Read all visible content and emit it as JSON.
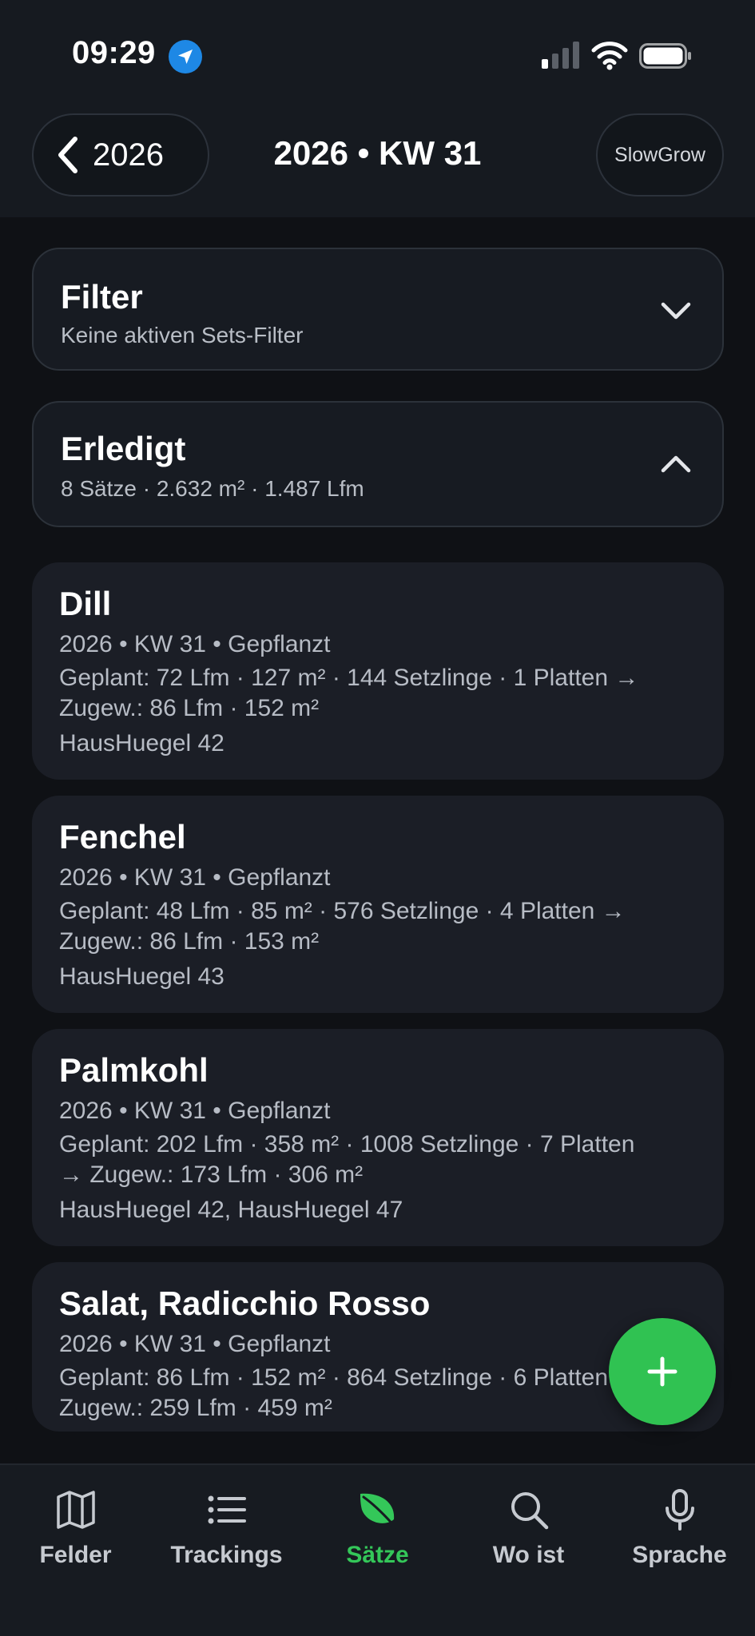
{
  "status_bar": {
    "time": "09:29"
  },
  "nav": {
    "back_label": "2026",
    "title": "2026 • KW 31",
    "right_label": "SlowGrow"
  },
  "filter": {
    "title": "Filter",
    "subtitle": "Keine aktiven Sets-Filter"
  },
  "erledigt": {
    "title": "Erledigt",
    "subtitle": "8 Sätze · 2.632 m² · 1.487 Lfm"
  },
  "sets": [
    {
      "name": "Dill",
      "meta": "2026 • KW 31 • Gepflanzt",
      "line1": "Geplant: 72 Lfm · 127 m² · 144 Setzlinge · 1 Platten →",
      "line2": "Zugew.: 86 Lfm · 152 m²",
      "location": "HausHuegel 42"
    },
    {
      "name": "Fenchel",
      "meta": "2026 • KW 31 • Gepflanzt",
      "line1": "Geplant: 48 Lfm · 85 m² · 576 Setzlinge · 4 Platten →",
      "line2": "Zugew.: 86 Lfm · 153 m²",
      "location": "HausHuegel 43"
    },
    {
      "name": "Palmkohl",
      "meta": "2026 • KW 31 • Gepflanzt",
      "line1": "Geplant: 202 Lfm · 358 m² · 1008 Setzlinge · 7 Platten",
      "line2": "→ Zugew.: 173 Lfm · 306 m²",
      "location": "HausHuegel 42, HausHuegel 47"
    },
    {
      "name": "Salat, Radicchio Rosso",
      "meta": "2026 • KW 31 • Gepflanzt",
      "line1": "Geplant: 86 Lfm · 152 m² · 864 Setzlinge · 6 Platten →",
      "line2": "Zugew.: 259 Lfm · 459 m²",
      "location": ""
    }
  ],
  "fab": {
    "icon": "plus-icon"
  },
  "tabs": [
    {
      "label": "Felder",
      "icon": "map-icon"
    },
    {
      "label": "Trackings",
      "icon": "list-icon"
    },
    {
      "label": "Sätze",
      "icon": "leaf-icon",
      "active": true
    },
    {
      "label": "Wo ist",
      "icon": "search-icon"
    },
    {
      "label": "Sprache",
      "icon": "microphone-icon"
    }
  ],
  "colors": {
    "accent": "#34c759",
    "background": "#0f1115",
    "card": "#1b1e26",
    "location_badge": "#1e88e5"
  }
}
